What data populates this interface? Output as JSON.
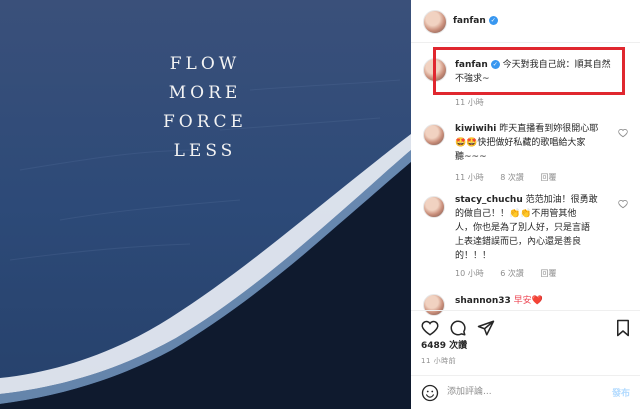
{
  "photo": {
    "quote_lines": [
      "FLOW",
      "MORE",
      "FORCE",
      "LESS"
    ]
  },
  "header": {
    "username": "fanfan"
  },
  "caption": {
    "username": "fanfan",
    "line1": "今天對我自己說：順其自然",
    "line2": "不強求~",
    "time": "11 小時"
  },
  "comments": [
    {
      "username": "kiwiwihi",
      "lines": [
        "昨天直播看到妳很開心耶",
        "🤩🤩快把做好私藏的歌唱給大家",
        "聽~~~"
      ],
      "time": "11 小時",
      "likes": "8 次讚",
      "reply": "回覆"
    },
    {
      "username": "stacy_chuchu",
      "lines": [
        "范范加油！很勇敢",
        "的做自己！！👏👏不用管其他",
        "人，你也是為了別人好，只是言語",
        "上表達錯誤而已，內心還是善良",
        "的！！！"
      ],
      "time": "10 小時",
      "likes": "6 次讚",
      "reply": "回覆"
    },
    {
      "username": "shannon33",
      "text": "早安❤️"
    }
  ],
  "likes": "6489 次讚",
  "timestamp": "11 小時前",
  "comment_input": {
    "placeholder": "添加評論...",
    "post_label": "發布"
  },
  "colors": {
    "highlight_box": "#e0272f",
    "verified": "#3897f0",
    "post_disabled": "#b3dbff"
  }
}
